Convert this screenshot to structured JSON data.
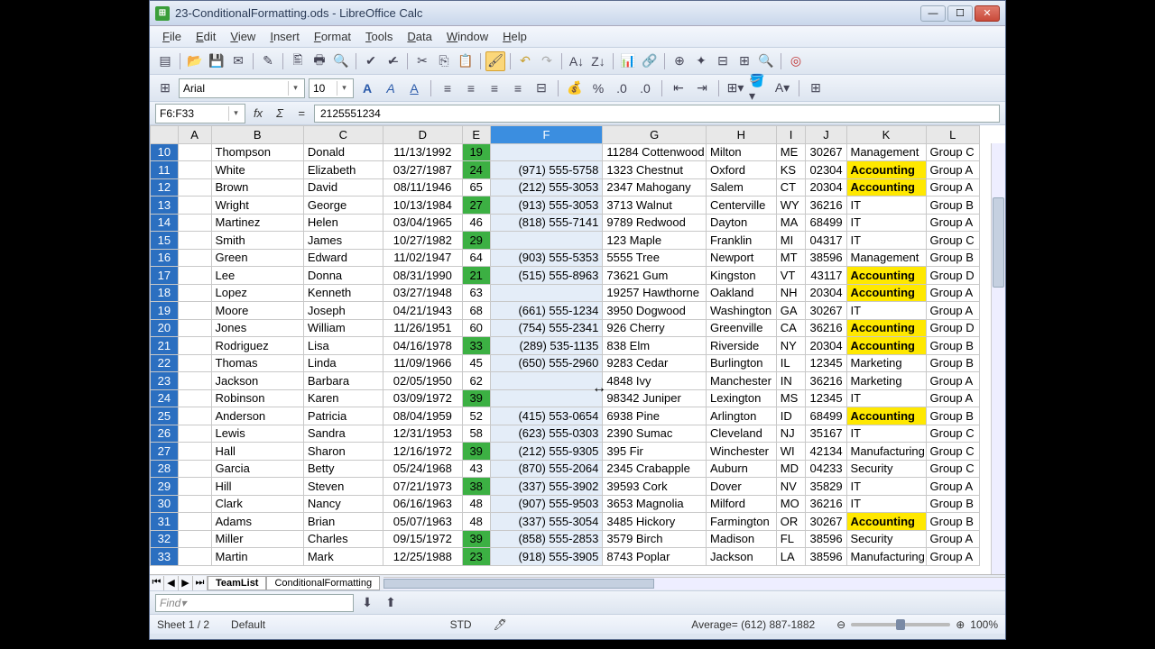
{
  "window": {
    "title": "23-ConditionalFormatting.ods - LibreOffice Calc"
  },
  "menu": [
    "File",
    "Edit",
    "View",
    "Insert",
    "Format",
    "Tools",
    "Data",
    "Window",
    "Help"
  ],
  "font": {
    "name": "Arial",
    "size": "10"
  },
  "formula": {
    "ref": "F6:F33",
    "value": "2125551234"
  },
  "columns": [
    "",
    "A",
    "B",
    "C",
    "D",
    "E",
    "F",
    "G",
    "H",
    "I",
    "J",
    "K",
    "L"
  ],
  "selected_col": "F",
  "tabs": {
    "active": "TeamList",
    "other": "ConditionalFormatting"
  },
  "find": {
    "placeholder": "Find"
  },
  "status": {
    "sheet": "Sheet 1 / 2",
    "style": "Default",
    "mode": "STD",
    "avg": "Average= (612) 887-1882",
    "zoom": "100%"
  },
  "colors": {
    "green": "#3cb043",
    "yellow": "#ffe800"
  },
  "chart_data": null,
  "rows": [
    {
      "n": 10,
      "b": "Thompson",
      "c": "Donald",
      "d": "11/13/1992",
      "e": "19",
      "eg": true,
      "f": "",
      "g": "11284 Cottenwood",
      "h": "Milton",
      "i": "ME",
      "j": "30267",
      "k": "Management",
      "ky": false,
      "l": "Group C"
    },
    {
      "n": 11,
      "b": "White",
      "c": "Elizabeth",
      "d": "03/27/1987",
      "e": "24",
      "eg": true,
      "f": "(971) 555-5758",
      "g": "1323 Chestnut",
      "h": "Oxford",
      "i": "KS",
      "j": "02304",
      "k": "Accounting",
      "ky": true,
      "l": "Group A"
    },
    {
      "n": 12,
      "b": "Brown",
      "c": "David",
      "d": "08/11/1946",
      "e": "65",
      "eg": false,
      "f": "(212) 555-3053",
      "g": "2347 Mahogany",
      "h": "Salem",
      "i": "CT",
      "j": "20304",
      "k": "Accounting",
      "ky": true,
      "l": "Group A"
    },
    {
      "n": 13,
      "b": "Wright",
      "c": "George",
      "d": "10/13/1984",
      "e": "27",
      "eg": true,
      "f": "(913) 555-3053",
      "g": "3713 Walnut",
      "h": "Centerville",
      "i": "WY",
      "j": "36216",
      "k": "IT",
      "ky": false,
      "l": "Group B"
    },
    {
      "n": 14,
      "b": "Martinez",
      "c": "Helen",
      "d": "03/04/1965",
      "e": "46",
      "eg": false,
      "f": "(818) 555-7141",
      "g": "9789 Redwood",
      "h": "Dayton",
      "i": "MA",
      "j": "68499",
      "k": "IT",
      "ky": false,
      "l": "Group A"
    },
    {
      "n": 15,
      "b": "Smith",
      "c": "James",
      "d": "10/27/1982",
      "e": "29",
      "eg": true,
      "f": "",
      "g": "123 Maple",
      "h": "Franklin",
      "i": "MI",
      "j": "04317",
      "k": "IT",
      "ky": false,
      "l": "Group C"
    },
    {
      "n": 16,
      "b": "Green",
      "c": "Edward",
      "d": "11/02/1947",
      "e": "64",
      "eg": false,
      "f": "(903) 555-5353",
      "g": "5555 Tree",
      "h": "Newport",
      "i": "MT",
      "j": "38596",
      "k": "Management",
      "ky": false,
      "l": "Group B"
    },
    {
      "n": 17,
      "b": "Lee",
      "c": "Donna",
      "d": "08/31/1990",
      "e": "21",
      "eg": true,
      "f": "(515) 555-8963",
      "g": "73621 Gum",
      "h": "Kingston",
      "i": "VT",
      "j": "43117",
      "k": "Accounting",
      "ky": true,
      "l": "Group D"
    },
    {
      "n": 18,
      "b": "Lopez",
      "c": "Kenneth",
      "d": "03/27/1948",
      "e": "63",
      "eg": false,
      "f": "",
      "g": "19257 Hawthorne",
      "h": "Oakland",
      "i": "NH",
      "j": "20304",
      "k": "Accounting",
      "ky": true,
      "l": "Group A"
    },
    {
      "n": 19,
      "b": "Moore",
      "c": "Joseph",
      "d": "04/21/1943",
      "e": "68",
      "eg": false,
      "f": "(661) 555-1234",
      "g": "3950 Dogwood",
      "h": "Washington",
      "i": "GA",
      "j": "30267",
      "k": "IT",
      "ky": false,
      "l": "Group A"
    },
    {
      "n": 20,
      "b": "Jones",
      "c": "William",
      "d": "11/26/1951",
      "e": "60",
      "eg": false,
      "f": "(754) 555-2341",
      "g": "926 Cherry",
      "h": "Greenville",
      "i": "CA",
      "j": "36216",
      "k": "Accounting",
      "ky": true,
      "l": "Group D"
    },
    {
      "n": 21,
      "b": "Rodriguez",
      "c": "Lisa",
      "d": "04/16/1978",
      "e": "33",
      "eg": true,
      "f": "(289) 535-1135",
      "g": "838 Elm",
      "h": "Riverside",
      "i": "NY",
      "j": "20304",
      "k": "Accounting",
      "ky": true,
      "l": "Group B"
    },
    {
      "n": 22,
      "b": "Thomas",
      "c": "Linda",
      "d": "11/09/1966",
      "e": "45",
      "eg": false,
      "f": "(650) 555-2960",
      "g": "9283 Cedar",
      "h": "Burlington",
      "i": "IL",
      "j": "12345",
      "k": "Marketing",
      "ky": false,
      "l": "Group B"
    },
    {
      "n": 23,
      "b": "Jackson",
      "c": "Barbara",
      "d": "02/05/1950",
      "e": "62",
      "eg": false,
      "f": "",
      "g": "4848 Ivy",
      "h": "Manchester",
      "i": "IN",
      "j": "36216",
      "k": "Marketing",
      "ky": false,
      "l": "Group A"
    },
    {
      "n": 24,
      "b": "Robinson",
      "c": "Karen",
      "d": "03/09/1972",
      "e": "39",
      "eg": true,
      "f": "",
      "g": "98342 Juniper",
      "h": "Lexington",
      "i": "MS",
      "j": "12345",
      "k": "IT",
      "ky": false,
      "l": "Group A"
    },
    {
      "n": 25,
      "b": "Anderson",
      "c": "Patricia",
      "d": "08/04/1959",
      "e": "52",
      "eg": false,
      "f": "(415) 553-0654",
      "g": "6938 Pine",
      "h": "Arlington",
      "i": "ID",
      "j": "68499",
      "k": "Accounting",
      "ky": true,
      "l": "Group B"
    },
    {
      "n": 26,
      "b": "Lewis",
      "c": "Sandra",
      "d": "12/31/1953",
      "e": "58",
      "eg": false,
      "f": "(623) 555-0303",
      "g": "2390 Sumac",
      "h": "Cleveland",
      "i": "NJ",
      "j": "35167",
      "k": "IT",
      "ky": false,
      "l": "Group C"
    },
    {
      "n": 27,
      "b": "Hall",
      "c": "Sharon",
      "d": "12/16/1972",
      "e": "39",
      "eg": true,
      "f": "(212) 555-9305",
      "g": "395 Fir",
      "h": "Winchester",
      "i": "WI",
      "j": "42134",
      "k": "Manufacturing",
      "ky": false,
      "l": "Group C"
    },
    {
      "n": 28,
      "b": "Garcia",
      "c": "Betty",
      "d": "05/24/1968",
      "e": "43",
      "eg": false,
      "f": "(870) 555-2064",
      "g": "2345 Crabapple",
      "h": "Auburn",
      "i": "MD",
      "j": "04233",
      "k": "Security",
      "ky": false,
      "l": "Group C"
    },
    {
      "n": 29,
      "b": "Hill",
      "c": "Steven",
      "d": "07/21/1973",
      "e": "38",
      "eg": true,
      "f": "(337) 555-3902",
      "g": "39593 Cork",
      "h": "Dover",
      "i": "NV",
      "j": "35829",
      "k": "IT",
      "ky": false,
      "l": "Group A"
    },
    {
      "n": 30,
      "b": "Clark",
      "c": "Nancy",
      "d": "06/16/1963",
      "e": "48",
      "eg": false,
      "f": "(907) 555-9503",
      "g": "3653 Magnolia",
      "h": "Milford",
      "i": "MO",
      "j": "36216",
      "k": "IT",
      "ky": false,
      "l": "Group B"
    },
    {
      "n": 31,
      "b": "Adams",
      "c": "Brian",
      "d": "05/07/1963",
      "e": "48",
      "eg": false,
      "f": "(337) 555-3054",
      "g": "3485 Hickory",
      "h": "Farmington",
      "i": "OR",
      "j": "30267",
      "k": "Accounting",
      "ky": true,
      "l": "Group B"
    },
    {
      "n": 32,
      "b": "Miller",
      "c": "Charles",
      "d": "09/15/1972",
      "e": "39",
      "eg": true,
      "f": "(858) 555-2853",
      "g": "3579 Birch",
      "h": "Madison",
      "i": "FL",
      "j": "38596",
      "k": "Security",
      "ky": false,
      "l": "Group A"
    },
    {
      "n": 33,
      "b": "Martin",
      "c": "Mark",
      "d": "12/25/1988",
      "e": "23",
      "eg": true,
      "f": "(918) 555-3905",
      "g": "8743 Poplar",
      "h": "Jackson",
      "i": "LA",
      "j": "38596",
      "k": "Manufacturing",
      "ky": false,
      "l": "Group A"
    }
  ]
}
